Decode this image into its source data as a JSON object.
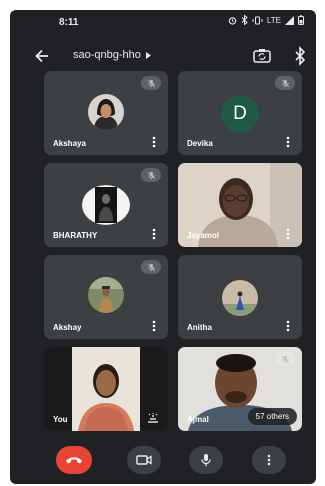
{
  "status_bar": {
    "time": "8:11",
    "network": "LTE"
  },
  "header": {
    "meeting_code": "sao-qnbg-hho"
  },
  "participants": [
    {
      "name": "Akshaya",
      "muted": true
    },
    {
      "name": "Devika",
      "muted": true,
      "initial": "D",
      "avatar_color": "#1e5a46"
    },
    {
      "name": "BHARATHY",
      "muted": true
    },
    {
      "name": "Jayamol",
      "muted": false
    },
    {
      "name": "Akshay",
      "muted": true
    },
    {
      "name": "Anitha",
      "muted": false
    },
    {
      "name": "You",
      "muted": false
    },
    {
      "name": "Ajmal",
      "muted": true
    }
  ],
  "others_badge": "57 others",
  "colors": {
    "background": "#202124",
    "tile": "#3c4043",
    "end_call": "#ea4335"
  },
  "icons": {
    "status": [
      "alarm-icon",
      "bluetooth-icon",
      "vibrate-icon",
      "signal-icon",
      "battery-icon"
    ],
    "header": [
      "back-arrow-icon",
      "switch-camera-icon",
      "bluetooth-icon"
    ],
    "controls": [
      "end-call-icon",
      "camera-icon",
      "microphone-icon",
      "more-options-icon"
    ]
  }
}
